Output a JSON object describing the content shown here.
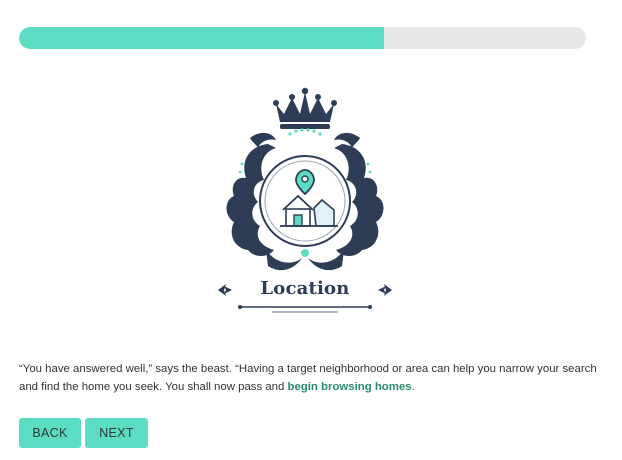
{
  "progress": {
    "fraction": 0.643,
    "fill_color": "#5cdcc3",
    "track_color": "#e8e8e8"
  },
  "badge": {
    "title": "Location",
    "icons": [
      "crown-icon",
      "location-pin-icon",
      "house-icon"
    ]
  },
  "story": {
    "text_before_link": "“You have answered well,” says the beast. “Having a target neighborhood or area can help you narrow your search and find the home you seek. You shall now pass and ",
    "link_text": "begin browsing homes",
    "text_after_link": "."
  },
  "buttons": {
    "back_label": "BACK",
    "next_label": "NEXT"
  },
  "colors": {
    "accent": "#5cdcc3",
    "navy": "#2d3d55",
    "link": "#2a8a6e"
  }
}
